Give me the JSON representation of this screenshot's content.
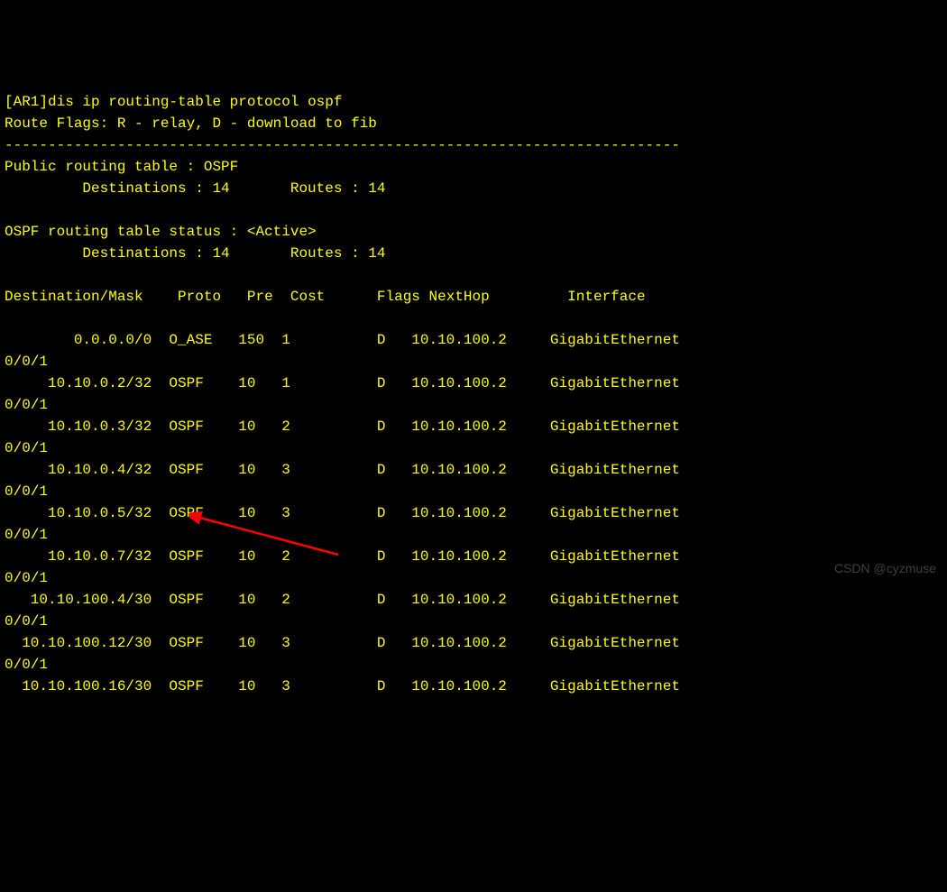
{
  "terminal": {
    "prompt": "[AR1]",
    "command": "dis ip routing-table protocol ospf",
    "route_flags": "Route Flags: R - relay, D - download to fib",
    "separator": "------------------------------------------------------------------------------",
    "public_table": "Public routing table : OSPF",
    "public_dest": "         Destinations : 14       Routes : 14",
    "status_header": "OSPF routing table status : <Active>",
    "status_dest": "         Destinations : 14       Routes : 14",
    "headers": {
      "dest": "Destination/Mask",
      "proto": "Proto",
      "pre": "Pre",
      "cost": "Cost",
      "flags": "Flags",
      "nexthop": "NextHop",
      "interface": "Interface"
    },
    "routes": [
      {
        "dest": "        0.0.0.0/0",
        "proto": "O_ASE",
        "pre": "150",
        "cost": "1",
        "flags": "D",
        "nexthop": "10.10.100.2",
        "interface": "GigabitEthernet",
        "iface_line": "0/0/1"
      },
      {
        "dest": "     10.10.0.2/32",
        "proto": "OSPF",
        "pre": "10",
        "cost": "1",
        "flags": "D",
        "nexthop": "10.10.100.2",
        "interface": "GigabitEthernet",
        "iface_line": "0/0/1"
      },
      {
        "dest": "     10.10.0.3/32",
        "proto": "OSPF",
        "pre": "10",
        "cost": "2",
        "flags": "D",
        "nexthop": "10.10.100.2",
        "interface": "GigabitEthernet",
        "iface_line": "0/0/1"
      },
      {
        "dest": "     10.10.0.4/32",
        "proto": "OSPF",
        "pre": "10",
        "cost": "3",
        "flags": "D",
        "nexthop": "10.10.100.2",
        "interface": "GigabitEthernet",
        "iface_line": "0/0/1"
      },
      {
        "dest": "     10.10.0.5/32",
        "proto": "OSPF",
        "pre": "10",
        "cost": "3",
        "flags": "D",
        "nexthop": "10.10.100.2",
        "interface": "GigabitEthernet",
        "iface_line": "0/0/1"
      },
      {
        "dest": "     10.10.0.7/32",
        "proto": "OSPF",
        "pre": "10",
        "cost": "2",
        "flags": "D",
        "nexthop": "10.10.100.2",
        "interface": "GigabitEthernet",
        "iface_line": "0/0/1"
      },
      {
        "dest": "   10.10.100.4/30",
        "proto": "OSPF",
        "pre": "10",
        "cost": "2",
        "flags": "D",
        "nexthop": "10.10.100.2",
        "interface": "GigabitEthernet",
        "iface_line": "0/0/1"
      },
      {
        "dest": "  10.10.100.12/30",
        "proto": "OSPF",
        "pre": "10",
        "cost": "3",
        "flags": "D",
        "nexthop": "10.10.100.2",
        "interface": "GigabitEthernet",
        "iface_line": "0/0/1"
      },
      {
        "dest": "  10.10.100.16/30",
        "proto": "OSPF",
        "pre": "10",
        "cost": "3",
        "flags": "D",
        "nexthop": "10.10.100.2",
        "interface": "GigabitEthernet",
        "iface_line": ""
      }
    ]
  },
  "watermark": "CSDN @cyzmuse"
}
